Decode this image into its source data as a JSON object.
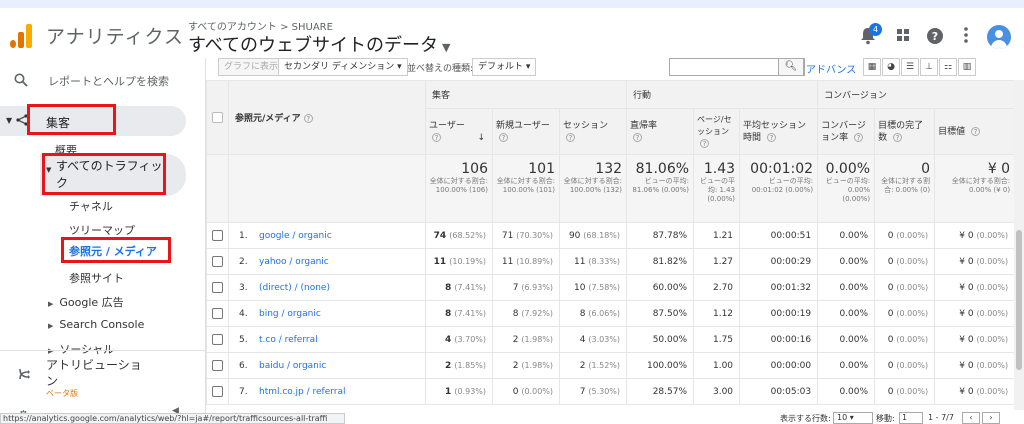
{
  "header": {
    "app_title": "アナリティクス",
    "breadcrumb": "すべてのアカウント > SHUARE",
    "view_title": "すべてのウェブサイトのデータ",
    "notification_count": "4"
  },
  "sidebar": {
    "search_label": "レポートとヘルプを検索",
    "acquisition": "集客",
    "overview": "概要",
    "all_traffic": "すべてのトラフィック",
    "channels": "チャネル",
    "treemap": "ツリーマップ",
    "source_medium": "参照元 / メディア",
    "referrals": "参照サイト",
    "google_ads": "Google 広告",
    "search_console": "Search Console",
    "social": "ソーシャル",
    "attribution": "アトリビューション",
    "beta": "ベータ版"
  },
  "toolbar": {
    "plot_rows": "グラフに表示",
    "secondary_dimension": "セカンダリ ディメンション",
    "sort_type_label": "並べ替えの種類:",
    "sort_default": "デフォルト",
    "advanced": "アドバンス"
  },
  "table": {
    "group_headers": {
      "acquisition": "集客",
      "behavior": "行動",
      "conversions": "コンバージョン"
    },
    "dimension_header": "参照元/メディア",
    "columns": [
      "ユーザー",
      "新規ユーザー",
      "セッション",
      "直帰率",
      "ページ/セッション",
      "平均セッション時間",
      "コンバージョン率",
      "目標の完了数",
      "目標値"
    ],
    "totals": [
      {
        "value": "106",
        "sub": "全体に対する割合: 100.00% (106)"
      },
      {
        "value": "101",
        "sub": "全体に対する割合: 100.00% (101)"
      },
      {
        "value": "132",
        "sub": "全体に対する割合: 100.00% (132)"
      },
      {
        "value": "81.06%",
        "sub": "ビューの平均: 81.06% (0.00%)"
      },
      {
        "value": "1.43",
        "sub": "ビューの平均: 1.43 (0.00%)"
      },
      {
        "value": "00:01:02",
        "sub": "ビューの平均: 00:01:02 (0.00%)"
      },
      {
        "value": "0.00%",
        "sub": "ビューの平均: 0.00% (0.00%)"
      },
      {
        "value": "0",
        "sub": "全体に対する割合: 0.00% (0)"
      },
      {
        "value": "¥ 0",
        "sub": "全体に対する割合: 0.00% (¥ 0)"
      }
    ],
    "rows": [
      {
        "n": "1.",
        "source": "google / organic",
        "users": "74",
        "users_pct": "(68.52%)",
        "new": "71",
        "new_pct": "(70.30%)",
        "sessions": "90",
        "sessions_pct": "(68.18%)",
        "bounce": "87.78%",
        "pps": "1.21",
        "dur": "00:00:51",
        "conv": "0.00%",
        "goal": "0",
        "goal_pct": "(0.00%)",
        "val": "¥ 0",
        "val_pct": "(0.00%)"
      },
      {
        "n": "2.",
        "source": "yahoo / organic",
        "users": "11",
        "users_pct": "(10.19%)",
        "new": "11",
        "new_pct": "(10.89%)",
        "sessions": "11",
        "sessions_pct": "(8.33%)",
        "bounce": "81.82%",
        "pps": "1.27",
        "dur": "00:00:29",
        "conv": "0.00%",
        "goal": "0",
        "goal_pct": "(0.00%)",
        "val": "¥ 0",
        "val_pct": "(0.00%)"
      },
      {
        "n": "3.",
        "source": "(direct) / (none)",
        "users": "8",
        "users_pct": "(7.41%)",
        "new": "7",
        "new_pct": "(6.93%)",
        "sessions": "10",
        "sessions_pct": "(7.58%)",
        "bounce": "60.00%",
        "pps": "2.70",
        "dur": "00:01:32",
        "conv": "0.00%",
        "goal": "0",
        "goal_pct": "(0.00%)",
        "val": "¥ 0",
        "val_pct": "(0.00%)"
      },
      {
        "n": "4.",
        "source": "bing / organic",
        "users": "8",
        "users_pct": "(7.41%)",
        "new": "8",
        "new_pct": "(7.92%)",
        "sessions": "8",
        "sessions_pct": "(6.06%)",
        "bounce": "87.50%",
        "pps": "1.12",
        "dur": "00:00:19",
        "conv": "0.00%",
        "goal": "0",
        "goal_pct": "(0.00%)",
        "val": "¥ 0",
        "val_pct": "(0.00%)"
      },
      {
        "n": "5.",
        "source": "t.co / referral",
        "users": "4",
        "users_pct": "(3.70%)",
        "new": "2",
        "new_pct": "(1.98%)",
        "sessions": "4",
        "sessions_pct": "(3.03%)",
        "bounce": "50.00%",
        "pps": "1.75",
        "dur": "00:00:16",
        "conv": "0.00%",
        "goal": "0",
        "goal_pct": "(0.00%)",
        "val": "¥ 0",
        "val_pct": "(0.00%)"
      },
      {
        "n": "6.",
        "source": "baidu / organic",
        "users": "2",
        "users_pct": "(1.85%)",
        "new": "2",
        "new_pct": "(1.98%)",
        "sessions": "2",
        "sessions_pct": "(1.52%)",
        "bounce": "100.00%",
        "pps": "1.00",
        "dur": "00:00:00",
        "conv": "0.00%",
        "goal": "0",
        "goal_pct": "(0.00%)",
        "val": "¥ 0",
        "val_pct": "(0.00%)"
      },
      {
        "n": "7.",
        "source": "html.co.jp / referral",
        "users": "1",
        "users_pct": "(0.93%)",
        "new": "0",
        "new_pct": "(0.00%)",
        "sessions": "7",
        "sessions_pct": "(5.30%)",
        "bounce": "28.57%",
        "pps": "3.00",
        "dur": "00:05:03",
        "conv": "0.00%",
        "goal": "0",
        "goal_pct": "(0.00%)",
        "val": "¥ 0",
        "val_pct": "(0.00%)"
      }
    ]
  },
  "status": {
    "url": "https://analytics.google.com/analytics/web/?hl=ja#/report/trafficsources-all-traffi",
    "rows_label": "表示する行数:",
    "rows_value": "10",
    "goto_label": "移動:",
    "goto_value": "1",
    "range": "1 - 7/7"
  },
  "colors": {
    "accent": "#1a73e8",
    "highlight": "#e8161b",
    "logo_orange": "#f9ab00",
    "logo_dark": "#e37400"
  }
}
